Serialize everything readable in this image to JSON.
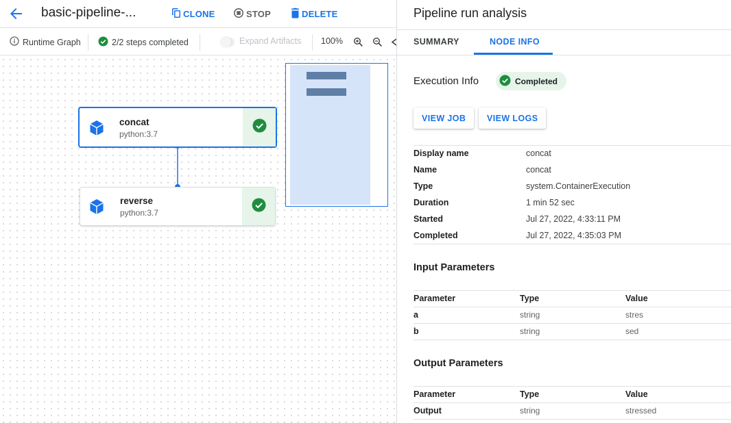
{
  "header": {
    "title": "basic-pipeline-...",
    "clone_label": "CLONE",
    "stop_label": "STOP",
    "delete_label": "DELETE"
  },
  "toolbar": {
    "runtime_graph_label": "Runtime Graph",
    "steps_completed": "2/2 steps completed",
    "expand_artifacts_label": "Expand Artifacts",
    "zoom_level": "100%"
  },
  "graph": {
    "nodes": [
      {
        "name": "concat",
        "image": "python:3.7",
        "status": "completed",
        "selected": true
      },
      {
        "name": "reverse",
        "image": "python:3.7",
        "status": "completed",
        "selected": false
      }
    ]
  },
  "panel": {
    "title": "Pipeline run analysis",
    "tabs": [
      {
        "label": "SUMMARY",
        "active": false
      },
      {
        "label": "NODE INFO",
        "active": true
      }
    ],
    "execution_info_label": "Execution Info",
    "status_badge": "Completed",
    "view_job_label": "VIEW JOB",
    "view_logs_label": "VIEW LOGS",
    "details": [
      {
        "key": "Display name",
        "value": "concat"
      },
      {
        "key": "Name",
        "value": "concat"
      },
      {
        "key": "Type",
        "value": "system.ContainerExecution"
      },
      {
        "key": "Duration",
        "value": "1 min 52 sec"
      },
      {
        "key": "Started",
        "value": "Jul 27, 2022, 4:33:11 PM"
      },
      {
        "key": "Completed",
        "value": "Jul 27, 2022, 4:35:03 PM"
      }
    ],
    "input_parameters": {
      "title": "Input Parameters",
      "headers": [
        "Parameter",
        "Type",
        "Value"
      ],
      "rows": [
        [
          "a",
          "string",
          "stres"
        ],
        [
          "b",
          "string",
          "sed"
        ]
      ]
    },
    "output_parameters": {
      "title": "Output Parameters",
      "headers": [
        "Parameter",
        "Type",
        "Value"
      ],
      "rows": [
        [
          "Output",
          "string",
          "stressed"
        ]
      ]
    }
  },
  "colors": {
    "accent": "#1a73e8",
    "success": "#1e8e3e",
    "success_bg": "#e6f4ea"
  }
}
